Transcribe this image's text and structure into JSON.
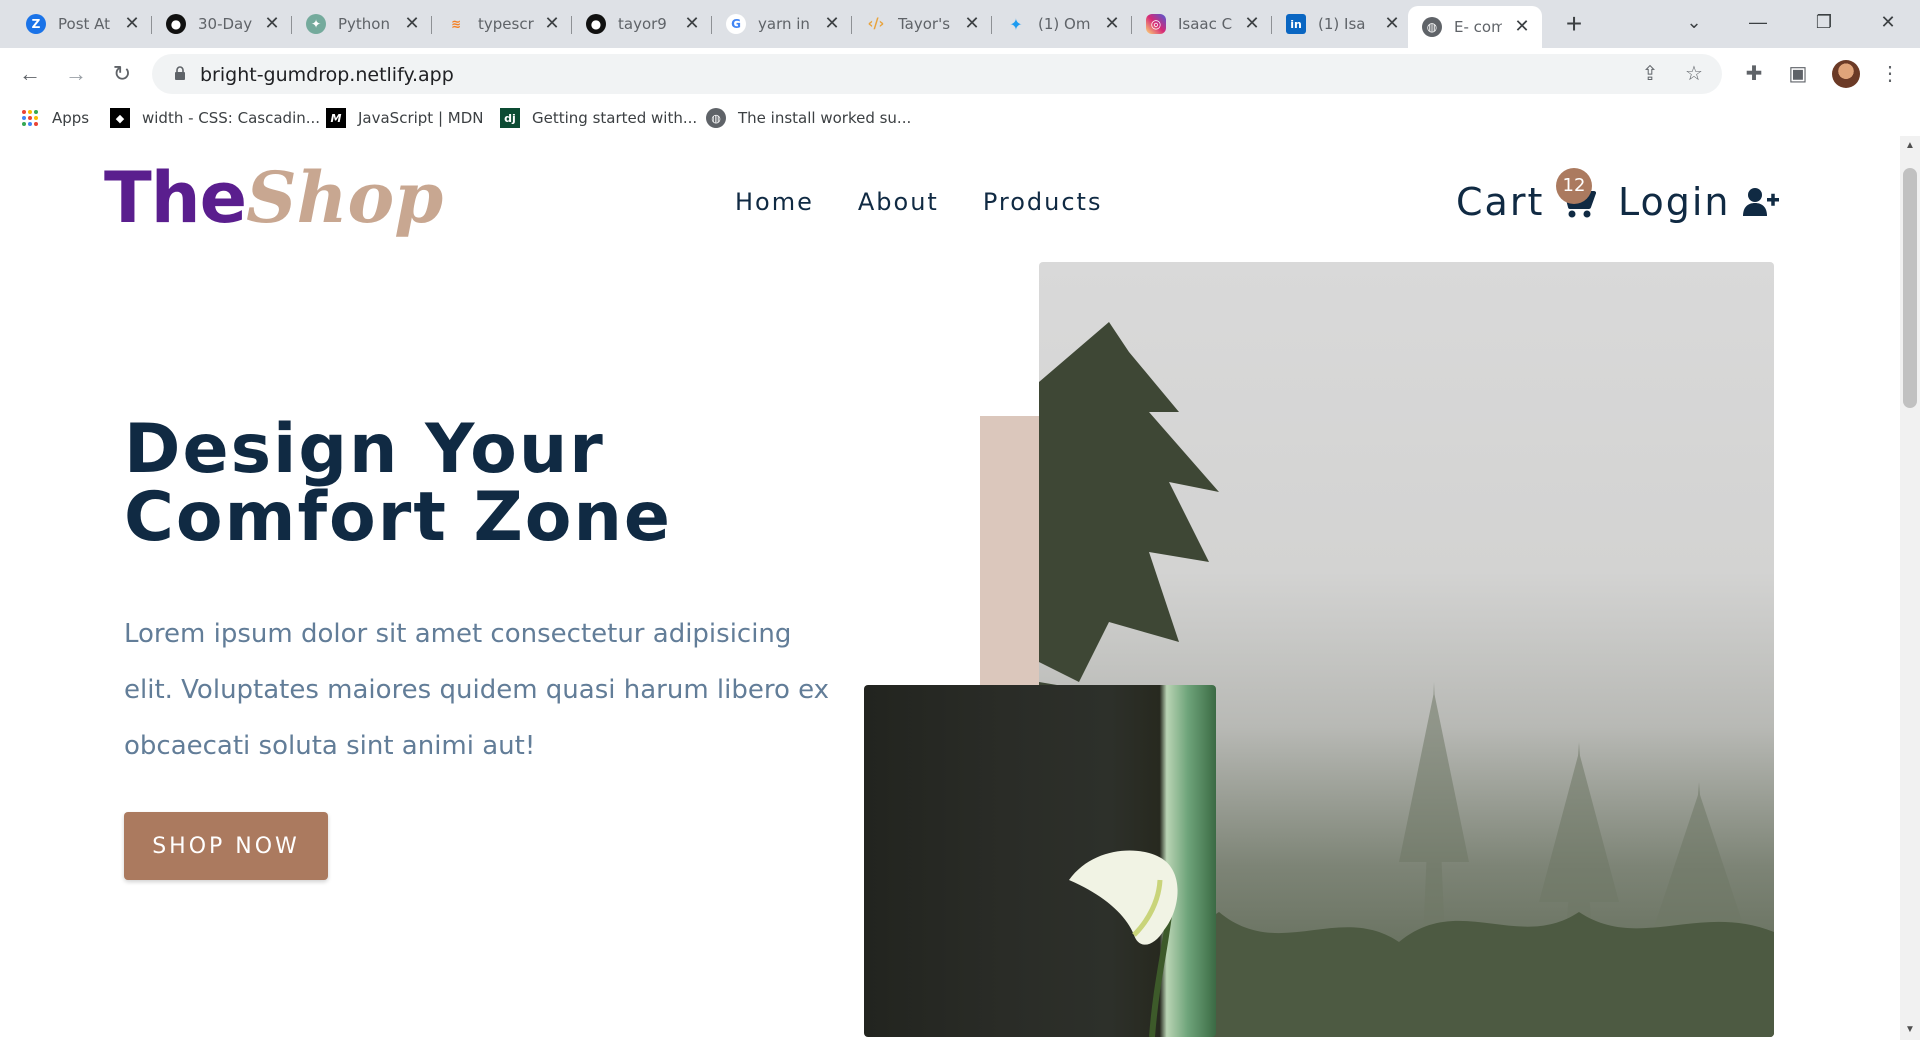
{
  "browser": {
    "tabs": [
      {
        "title": "Post At",
        "icon": "zoho-icon",
        "color": "#1a73e8",
        "glyph": "Z"
      },
      {
        "title": "30-Day",
        "icon": "github-icon",
        "color": "#111111",
        "glyph": ""
      },
      {
        "title": "Python",
        "icon": "chatgpt-icon",
        "color": "#74aa9c",
        "glyph": ""
      },
      {
        "title": "typescr",
        "icon": "stackoverflow-icon",
        "color": "#f48024",
        "glyph": ""
      },
      {
        "title": "tayor9",
        "icon": "github-icon",
        "color": "#111111",
        "glyph": ""
      },
      {
        "title": "yarn in",
        "icon": "google-icon",
        "color": "#ffffff",
        "glyph": "G"
      },
      {
        "title": "Tayor's",
        "icon": "code-icon",
        "color": "#e8a33d",
        "glyph": "‹/›"
      },
      {
        "title": "(1) Om",
        "icon": "twitter-icon",
        "color": "#1d9bf0",
        "glyph": ""
      },
      {
        "title": "Isaac C",
        "icon": "instagram-icon",
        "color": "#d62976",
        "glyph": ""
      },
      {
        "title": "(1) Isa",
        "icon": "linkedin-icon",
        "color": "#0a66c2",
        "glyph": "in"
      },
      {
        "title": "E- com",
        "icon": "globe-icon",
        "color": "#5f6368",
        "glyph": "",
        "active": true
      }
    ],
    "url": "bright-gumdrop.netlify.app",
    "bookmarks": [
      {
        "label": "Apps",
        "icon": "apps-grid-icon"
      },
      {
        "label": "width - CSS: Cascadin...",
        "icon": "mdn-icon"
      },
      {
        "label": "JavaScript | MDN",
        "icon": "mdn-icon"
      },
      {
        "label": "Getting started with...",
        "icon": "django-icon"
      },
      {
        "label": "The install worked su...",
        "icon": "globe-icon"
      }
    ]
  },
  "site": {
    "logo": {
      "part1": "The",
      "part2": "Shop"
    },
    "nav": [
      "Home",
      "About",
      "Products"
    ],
    "cart": {
      "label": "Cart",
      "count": "12"
    },
    "login": {
      "label": "Login"
    },
    "hero": {
      "title_line1": "Design Your",
      "title_line2": "Comfort Zone",
      "text": "Lorem ipsum dolor sit amet consectetur adipisicing elit. Voluptates maiores quidem quasi harum libero ex obcaecati soluta sint animi aut!",
      "button": "SHOP NOW"
    }
  },
  "colors": {
    "primary": "#102a43",
    "accent": "#ab7a5f",
    "logo_purple": "#5a1e8e",
    "logo_tan": "#c8a791",
    "text_muted": "#627d98"
  }
}
